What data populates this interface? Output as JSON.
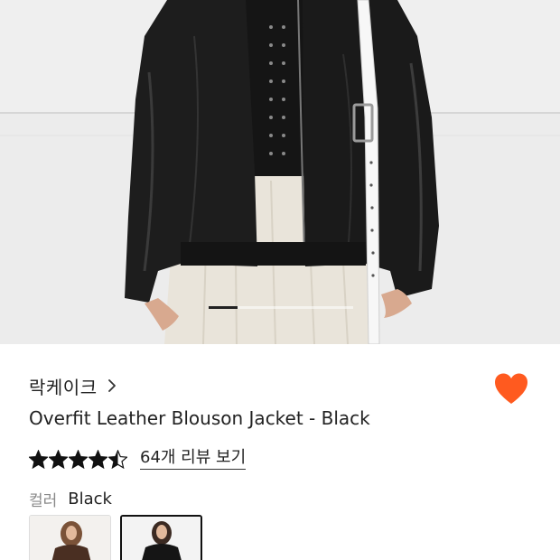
{
  "product": {
    "brand": "락케이크",
    "title": "Overfit Leather Blouson Jacket - Black",
    "rating": 4.5,
    "review_link": "64개 리뷰 보기",
    "color_label": "컬러",
    "color_value": "Black",
    "liked": true
  },
  "gallery": {
    "current_index": 1
  },
  "color_options": [
    {
      "name": "brown",
      "selected": false
    },
    {
      "name": "black",
      "selected": true
    }
  ],
  "colors": {
    "heart": "#ff5a1f",
    "star": "#111111",
    "background": "#ffffff"
  },
  "icons": {
    "brand_chevron": "chevron-right-icon",
    "like": "heart-icon",
    "star": "star-icon"
  }
}
